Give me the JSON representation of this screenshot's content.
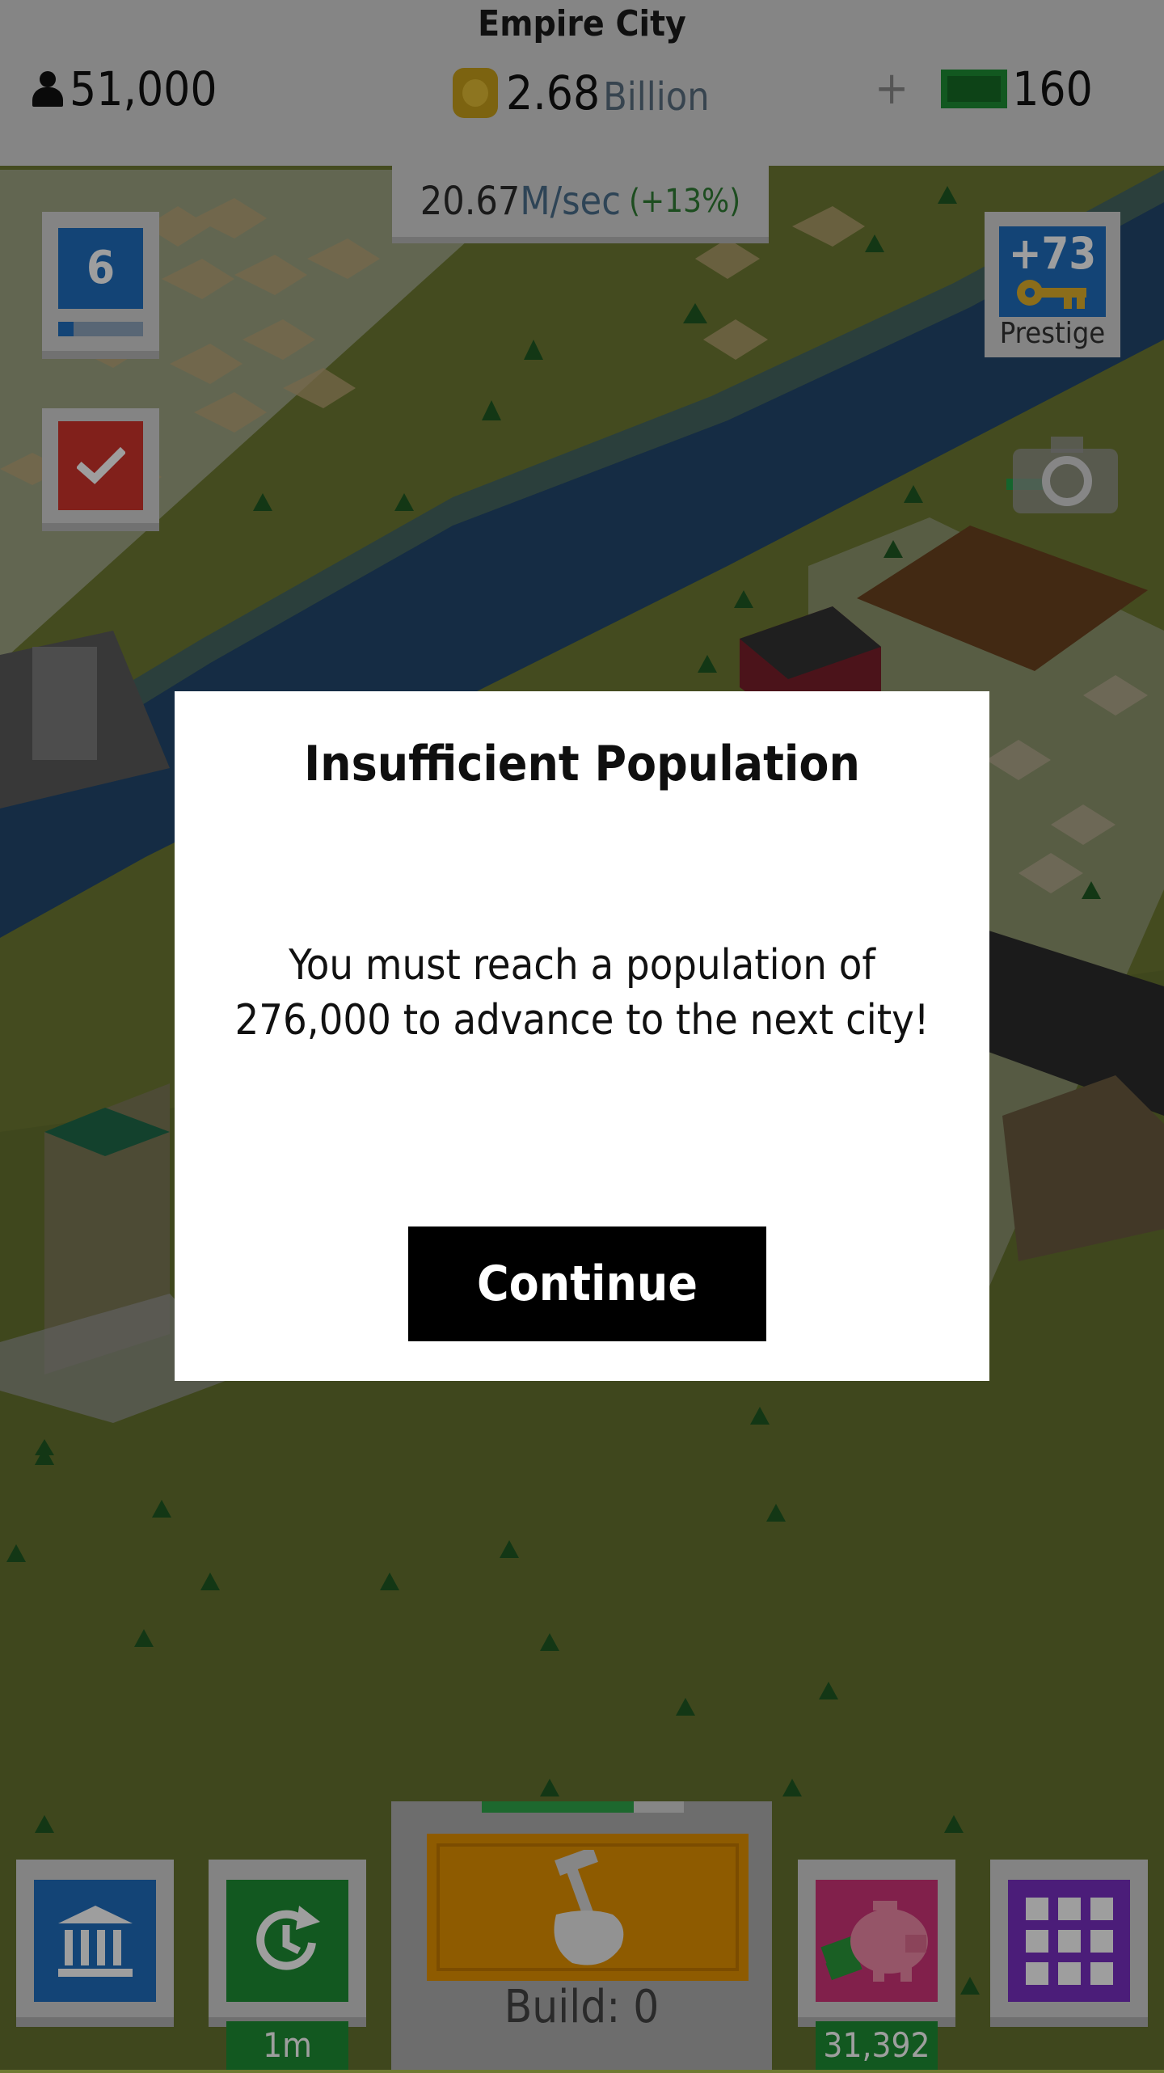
{
  "hud": {
    "city_name": "Empire City",
    "population": "51,000",
    "coins_value": "2.68",
    "coins_unit": "Billion",
    "plus_symbol": "+",
    "cash": "160",
    "rate_value": "20.67",
    "rate_unit": "M/sec",
    "rate_bonus": "(+13%)"
  },
  "side": {
    "level": "6",
    "level_progress": 0.18,
    "prestige_bonus": "+73",
    "prestige_label": "Prestige"
  },
  "bottom": {
    "timer_label": "1m",
    "build_label": "Build: 0",
    "build_progress": 0.75,
    "bank_value": "31,392"
  },
  "dialog": {
    "title": "Insufficient Population",
    "message": "You must reach a population of\n276,000  to advance to the next city!",
    "button_label": "Continue"
  },
  "icons": [
    "person-icon",
    "coin-icon",
    "cash-icon",
    "check-icon",
    "key-icon",
    "camera-icon",
    "museum-icon",
    "clock-icon",
    "hammer-hand-icon",
    "piggy-bank-icon",
    "grid-menu-icon"
  ],
  "colors": {
    "accent_blue": "#1f6fbf",
    "accent_green": "#1e8e34",
    "accent_red": "#d1342c",
    "accent_purple": "#7a2fc4",
    "accent_pink": "#d1357a",
    "build_orange": "#e69400"
  }
}
